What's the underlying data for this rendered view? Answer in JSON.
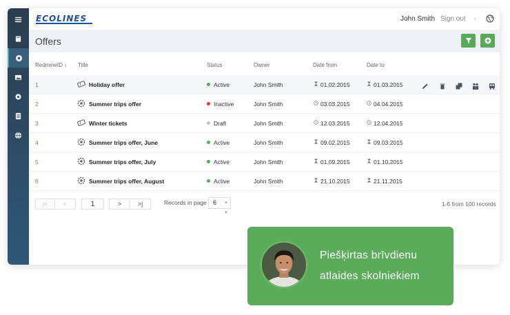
{
  "app": {
    "logo_text": "ECOLINES",
    "user_name": "John Smith",
    "sign_out": "Sign out",
    "separator": "·",
    "page_title": "Offers"
  },
  "sidebar": {
    "items": [
      {
        "icon": "hamburger-menu-icon"
      },
      {
        "icon": "book-icon"
      },
      {
        "icon": "gear-star-icon",
        "active": true
      },
      {
        "icon": "picture-icon"
      },
      {
        "icon": "gear-icon"
      },
      {
        "icon": "document-icon"
      },
      {
        "icon": "globe-icon"
      }
    ]
  },
  "table": {
    "columns": [
      "RedmineID ↓",
      "Title",
      "Status",
      "Owner",
      "Date from",
      "Date to"
    ],
    "rows": [
      {
        "id": "1",
        "title": "Holiday offer",
        "icon": "ticket-icon",
        "status": "Active",
        "status_color": "#4caf50",
        "owner": "John Smith",
        "date_from": "01.02.2015",
        "date_to": "01.03.2015",
        "date_icon": "hourglass-icon"
      },
      {
        "id": "2",
        "title": "Summer trips offer",
        "icon": "gear-badge-icon",
        "status": "Inactive",
        "status_color": "#e53935",
        "owner": "John Smith",
        "date_from": "03.03.2015",
        "date_to": "04.04.2015",
        "date_icon": "clock-icon"
      },
      {
        "id": "3",
        "title": "Winter tickets",
        "icon": "ticket-icon",
        "status": "Draft",
        "status_color": "#c0c4cc",
        "owner": "John Smith",
        "date_from": "12.03.2015",
        "date_to": "12.04.2015",
        "date_icon": "clock-icon"
      },
      {
        "id": "4",
        "title": "Summer trips offer, June",
        "icon": "gear-badge-icon",
        "status": "Active",
        "status_color": "#4caf50",
        "owner": "John Smith",
        "date_from": "09.02.2015",
        "date_to": "09.03.2015",
        "date_icon": "hourglass-icon"
      },
      {
        "id": "5",
        "title": "Summer trips offer, July",
        "icon": "gear-badge-icon",
        "status": "Active",
        "status_color": "#4caf50",
        "owner": "John Smith",
        "date_from": "01.09.2015",
        "date_to": "01.10.2015",
        "date_icon": "hourglass-icon"
      },
      {
        "id": "6",
        "title": "Summer trips offer, August",
        "icon": "gear-badge-icon",
        "status": "Active",
        "status_color": "#4caf50",
        "owner": "John Smith",
        "date_from": "21.10.2015",
        "date_to": "21.11.2015",
        "date_icon": "hourglass-icon"
      }
    ],
    "row_actions": [
      "edit-icon",
      "delete-icon",
      "copy-icon",
      "users-icon",
      "bus-icon"
    ]
  },
  "pagination": {
    "first": "|<",
    "prev": "<",
    "page": "1",
    "next": ">",
    "last": ">|",
    "records_label": "Records in page",
    "records_value": "6",
    "records_count": "1-6 from 100 records"
  },
  "promo": {
    "line1": "Piešķirtas brīvdienu",
    "line2": "atlaides skolniekiem"
  },
  "colors": {
    "accent_green": "#5aab5a",
    "sidebar": "#2f5777",
    "logo_blue": "#1f4e9a"
  }
}
